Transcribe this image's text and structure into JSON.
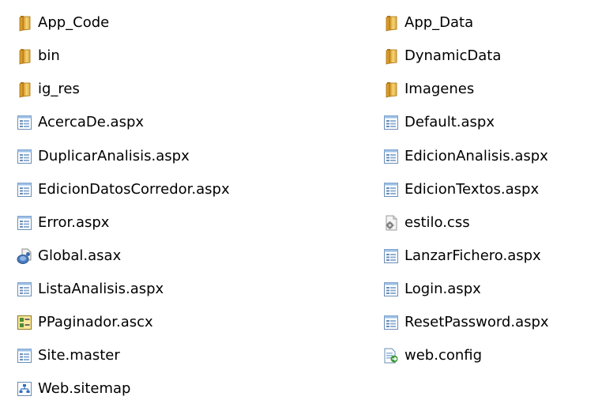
{
  "files": {
    "app_code": "App_Code",
    "app_data": "App_Data",
    "bin": "bin",
    "dynamicdata": "DynamicData",
    "ig_res": "ig_res",
    "imagenes": "Imagenes",
    "acercade": "AcercaDe.aspx",
    "default": "Default.aspx",
    "duplicaranalisis": "DuplicarAnalisis.aspx",
    "edicionanalisis": "EdicionAnalisis.aspx",
    "ediciondatoscorredor": "EdicionDatosCorredor.aspx",
    "ediciontextos": "EdicionTextos.aspx",
    "error": "Error.aspx",
    "estilo": "estilo.css",
    "global": "Global.asax",
    "lanzarfichero": "LanzarFichero.aspx",
    "listaanalisis": "ListaAnalisis.aspx",
    "login": "Login.aspx",
    "ppaginador": "PPaginador.ascx",
    "resetpassword": "ResetPassword.aspx",
    "sitemaster": "Site.master",
    "webconfig": "web.config",
    "websitemap": "Web.sitemap"
  },
  "icons": {
    "folder": "folder-icon",
    "aspx": "aspx-page-icon",
    "css": "css-file-icon",
    "asax": "asax-file-icon",
    "ascx": "user-control-icon",
    "config": "config-file-icon",
    "sitemap": "sitemap-file-icon"
  },
  "colors": {
    "folder": "#e8b53c",
    "page_border": "#5a7fa8"
  }
}
